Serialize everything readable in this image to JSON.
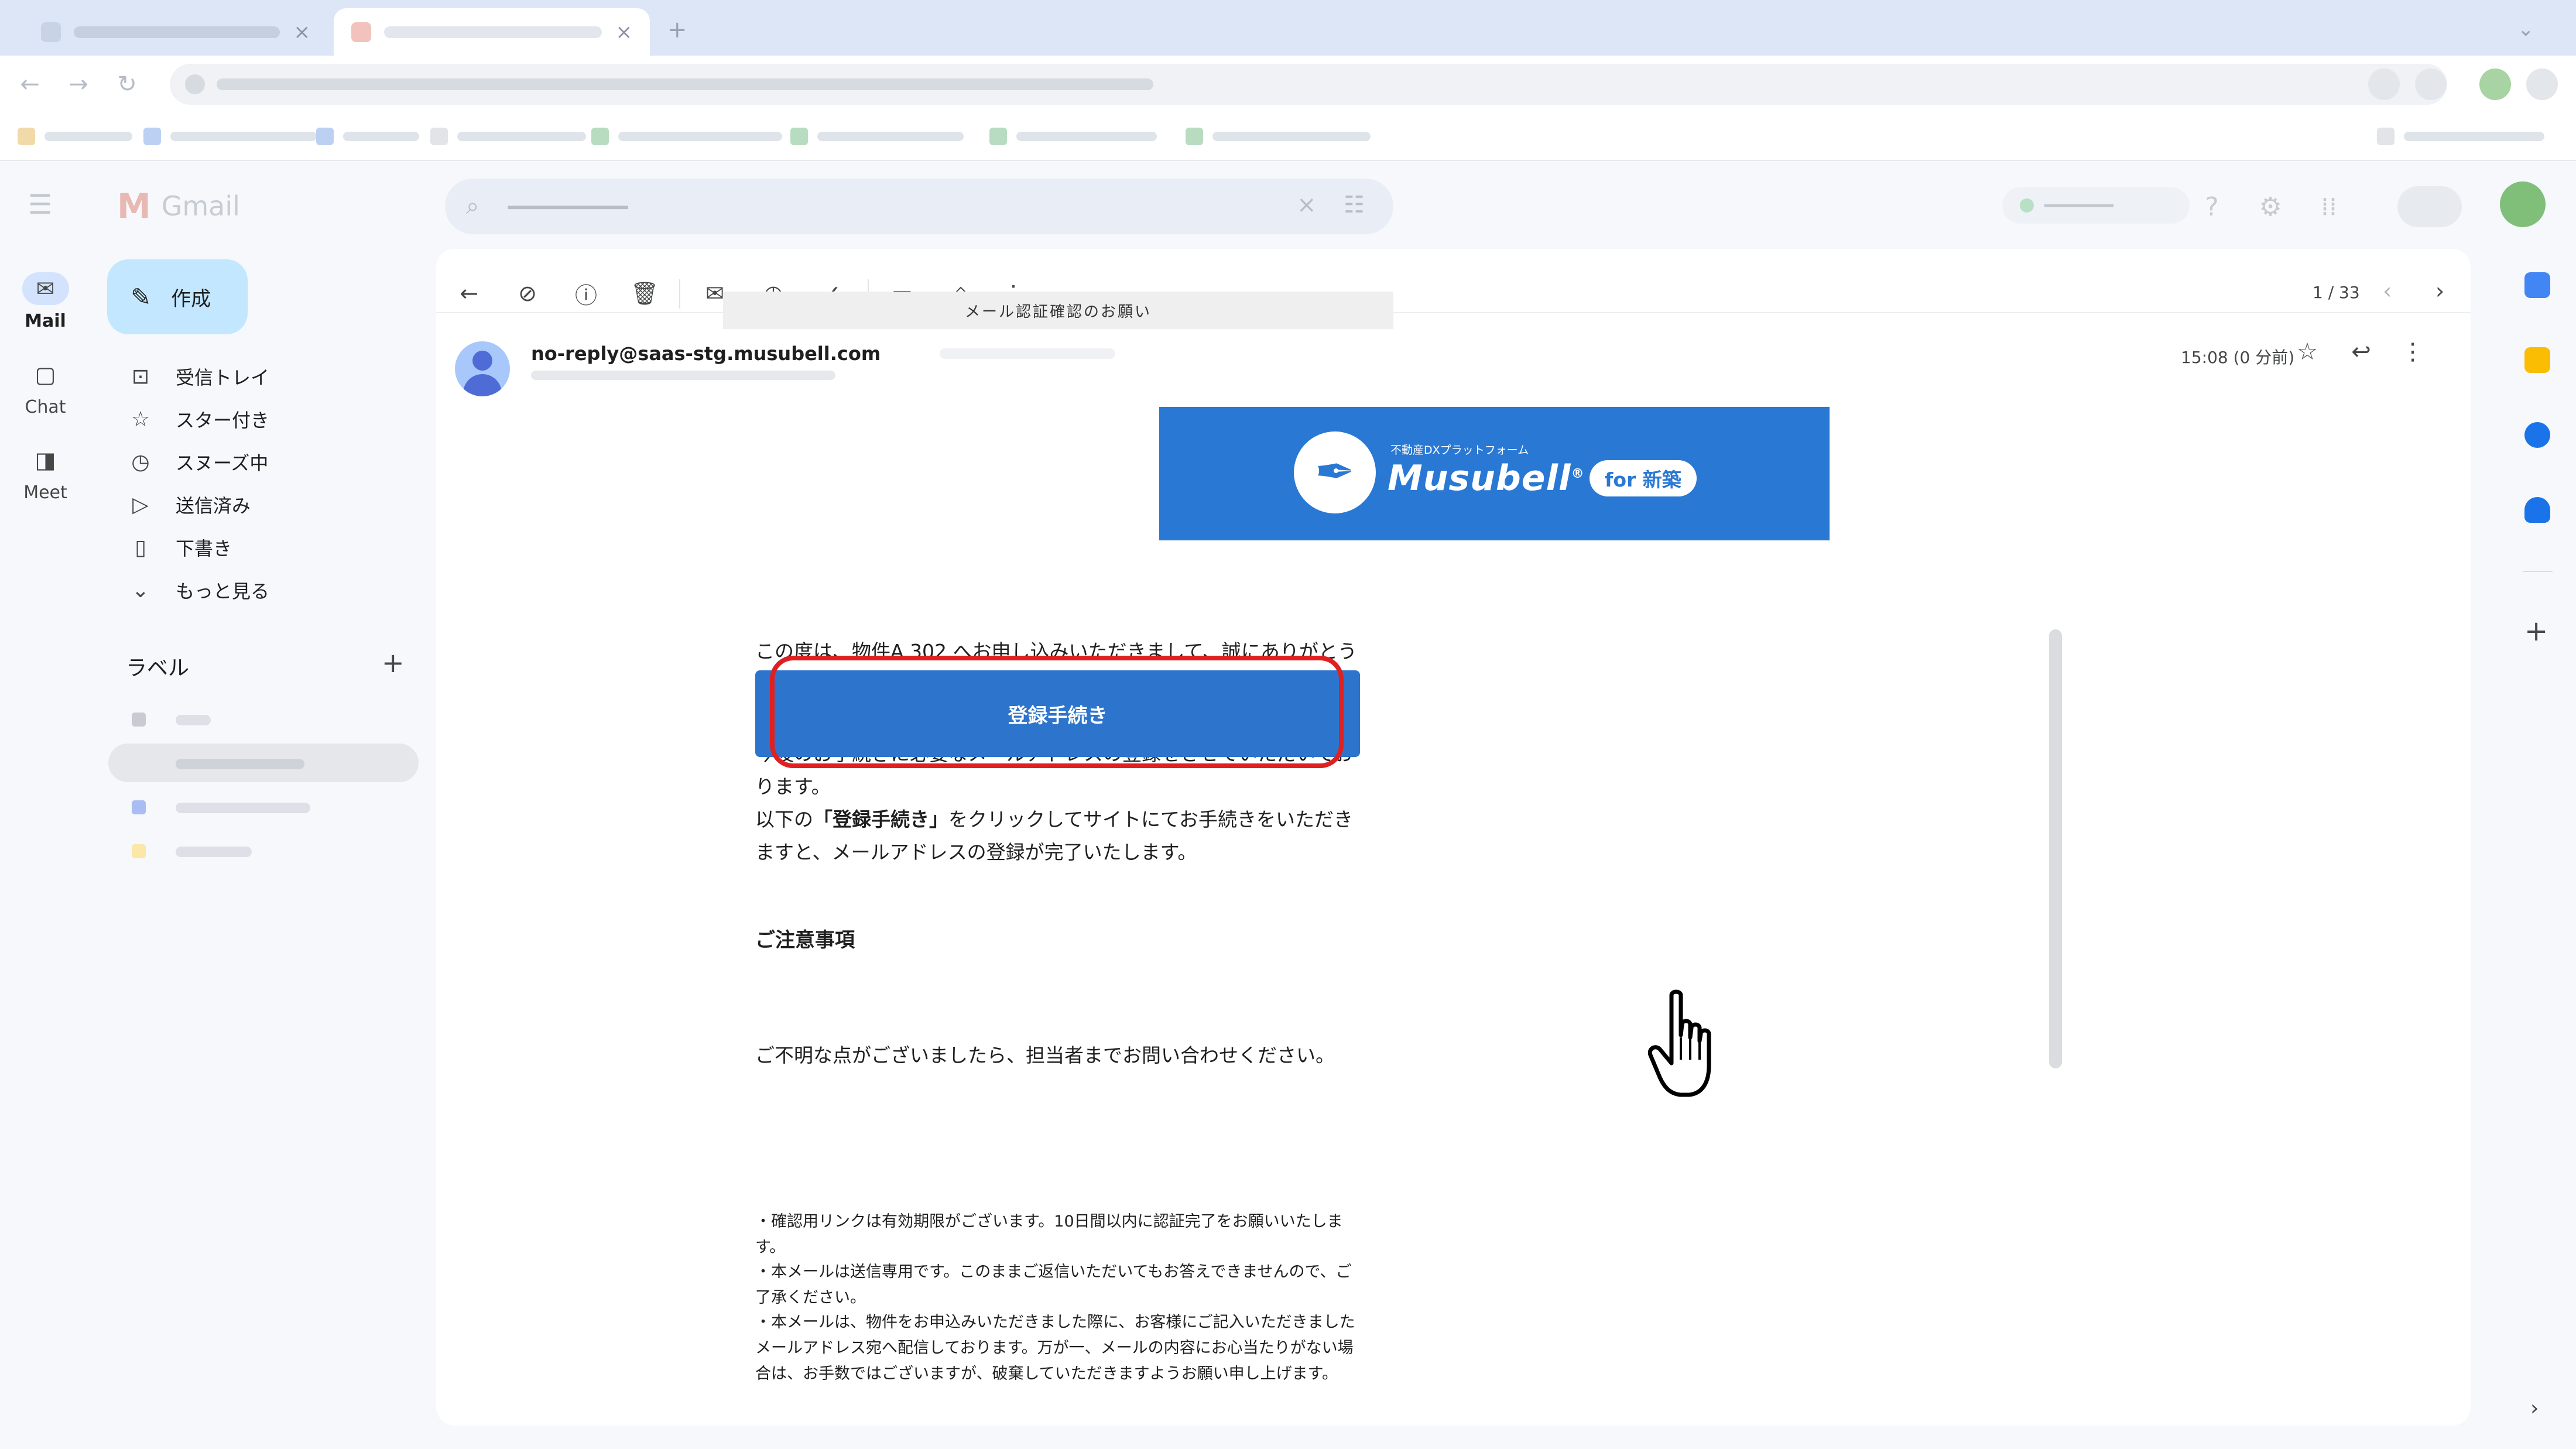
{
  "colors": {
    "banner_blue": "#2978d4",
    "cta_blue": "#2c74cc",
    "highlight_red": "#e02020",
    "compose_bg": "#c2e7ff",
    "active_rail": "#d3e3fd"
  },
  "rail": {
    "mail_label": "Mail",
    "chat_label": "Chat",
    "meet_label": "Meet"
  },
  "sidebar": {
    "compose_label": "作成",
    "items": [
      {
        "label": "受信トレイ",
        "icon": "inbox-icon"
      },
      {
        "label": "スター付き",
        "icon": "star-icon"
      },
      {
        "label": "スヌーズ中",
        "icon": "clock-icon"
      },
      {
        "label": "送信済み",
        "icon": "send-icon"
      },
      {
        "label": "下書き",
        "icon": "draft-icon"
      },
      {
        "label": "もっと見る",
        "icon": "chevron-down-icon"
      }
    ],
    "labels_title": "ラベル"
  },
  "toolbar": {
    "pager": "1 / 33"
  },
  "message": {
    "sender": "no-reply@saas-stg.musubell.com",
    "timestamp": "15:08 (0 分前)"
  },
  "email": {
    "tagline": "不動産DXプラットフォーム",
    "brand": "Musubell",
    "brand_mark": "®",
    "for_badge": "for 新築",
    "subheader": "メール認証確認のお願い",
    "para1": "この度は、物件A 302 へお申し込みいただきまして、誠にありがとうございます。",
    "para2a": "今後のお手続きに必要なメールアドレスの登録をさせていただいております。",
    "para2b_pre": "以下の",
    "para2b_bold": "「登録手続き」",
    "para2b_post": "をクリックしてサイトにてお手続きをいただきますと、メールアドレスの登録が完了いたします。",
    "cta_label": "登録手続き",
    "para3": "ご不明な点がございましたら、担当者までお問い合わせください。",
    "notes_title": "ご注意事項",
    "notes": [
      "・確認用リンクは有効期限がございます。10日間以内に認証完了をお願いいたします。",
      "・本メールは送信専用です。このままご返信いただいてもお答えできませんので、ご了承ください。",
      "・本メールは、物件をお申込みいただきました際に、お客様にご記入いただきましたメールアドレス宛へ配信しております。万が一、メールの内容にお心当たりがない場合は、お手数ではございますが、破棄していただきますようお願い申し上げます。"
    ]
  }
}
